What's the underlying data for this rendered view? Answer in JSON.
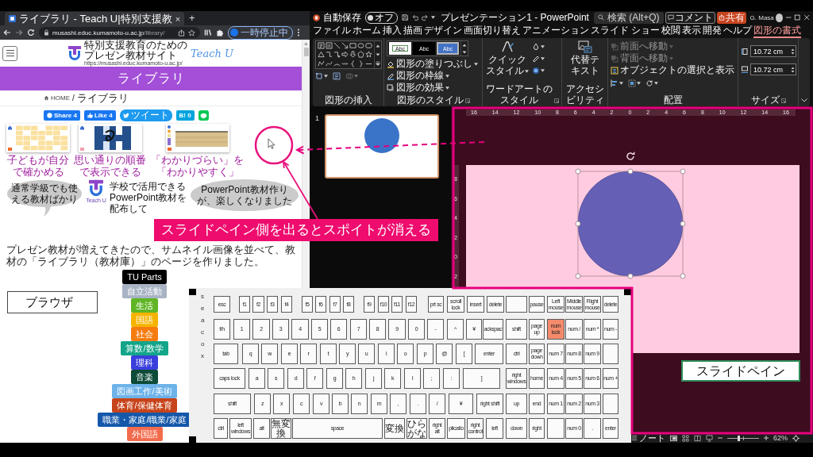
{
  "browser": {
    "tab": {
      "title": "ライブラリ - Teach U|特別支援教",
      "close": "×"
    },
    "new_tab": "+",
    "address": {
      "host": "musashi.educ.kumamoto-u.ac.jp",
      "path": "/library/"
    },
    "profile": {
      "status": "一時停止中"
    },
    "page": {
      "logo": {
        "line_1": "特別支援教育のための",
        "line_2": "プレゼン教材サイト",
        "url": "https://musashi.educ.kumamoto-u.ac.jp/",
        "brand": "Teach U"
      },
      "banner_title": "ライブラリ",
      "breadcrumb": {
        "home": "HOME",
        "separator": "/",
        "current": "ライブラリ"
      },
      "share_buttons": [
        {
          "kind": "share",
          "label": "Share 4"
        },
        {
          "kind": "like",
          "label": "Like 4"
        },
        {
          "kind": "tweet",
          "label": "ツイート"
        },
        {
          "kind": "bookmark",
          "label": "B! 0"
        },
        {
          "kind": "chat"
        }
      ],
      "thumbnails": [
        {
          "kind": "kana_grid",
          "caption": "子どもが自分で確かめる"
        },
        {
          "kind": "letter_tile",
          "caption": "思い通りの順番で表示できる"
        },
        {
          "kind": "ruler",
          "caption": "「わかりづらい」を「わかりやすく」"
        }
      ],
      "speech_bubble": "通常学級でも使える教材ばかり",
      "logo_caption": "Teach U",
      "intro_lines": [
        "学校で活用できる",
        "PowerPoint教材を",
        "配布して"
      ],
      "thought_bubble": "PowerPoint教材作りが、楽しくなりました",
      "paragraph": "プレゼン教材が増えてきたので、サムネイル画像を並べて、教材の「ライブラリ（教材庫）」のページを作りました。",
      "categories": [
        {
          "label": "TU Parts",
          "color": "#000000"
        },
        {
          "label": "自立活動",
          "color": "#a8b3c4"
        },
        {
          "label": "生活",
          "color": "#5fb524"
        },
        {
          "label": "国語",
          "color": "#f6b400"
        },
        {
          "label": "社会",
          "color": "#f67c0f"
        },
        {
          "label": "算数/数学",
          "color": "#12a58a"
        },
        {
          "label": "理科",
          "color": "#3a3fdc"
        },
        {
          "label": "音楽",
          "color": "#0d4a38"
        },
        {
          "label": "図画工作/美術",
          "color": "#6db3ea"
        },
        {
          "label": "体育/保健体育",
          "color": "#c7431a"
        },
        {
          "label": "職業・家庭/職業/家庭",
          "color": "#1558aa"
        },
        {
          "label": "外国語",
          "color": "#f26b4c"
        }
      ]
    }
  },
  "powerpoint": {
    "title_bar": {
      "autosave_label": "自動保存",
      "autosave": {
        "on": false,
        "label": "オフ"
      },
      "document_title": "プレゼンテーション1 - PowerPoint",
      "search_placeholder": "検索 (Alt+Q)",
      "user_name": "G. Masa"
    },
    "tabs": [
      {
        "label": "ファイル",
        "selected": false
      },
      {
        "label": "ホーム",
        "selected": false
      },
      {
        "label": "挿入",
        "selected": false
      },
      {
        "label": "描画",
        "selected": false
      },
      {
        "label": "デザイン",
        "selected": false
      },
      {
        "label": "画面切り替え",
        "selected": false
      },
      {
        "label": "アニメーション",
        "selected": false
      },
      {
        "label": "スライド ショー",
        "selected": false
      },
      {
        "label": "校閲",
        "selected": false
      },
      {
        "label": "表示",
        "selected": false
      },
      {
        "label": "開発",
        "selected": false
      },
      {
        "label": "ヘルプ",
        "selected": false
      },
      {
        "label": "図形の書式",
        "selected": true
      }
    ],
    "comment_button": "コメント",
    "share_button": "共有",
    "ribbon": {
      "insert_shapes_label": "図形の挿入",
      "shape_styles": {
        "label": "図形のスタイル",
        "swatches": [
          {
            "kind": "outline",
            "label": "Abc",
            "selected": false
          },
          {
            "kind": "dark",
            "label": "Abc",
            "selected": false
          },
          {
            "kind": "accent",
            "label": "Abc",
            "selected": true
          }
        ],
        "commands": [
          {
            "kind": "fill",
            "label": "図形の塗りつぶし"
          },
          {
            "kind": "outline",
            "label": "図形の枠線"
          },
          {
            "kind": "effects",
            "label": "図形の効果"
          }
        ]
      },
      "wordart": {
        "label": "ワードアートのスタイル",
        "quick_styles": "クイックスタイル"
      },
      "accessibility": {
        "label": "アクセシビリティ",
        "alt_text": "代替テキスト"
      },
      "arrange": {
        "label": "配置",
        "commands": [
          {
            "kind": "bring_forward",
            "label": "前面へ移動",
            "disabled": true
          },
          {
            "kind": "send_backward",
            "label": "背面へ移動",
            "disabled": true
          },
          {
            "kind": "selection_pane",
            "label": "オブジェクトの選択と表示",
            "disabled": false
          }
        ]
      },
      "size": {
        "label": "サイズ",
        "fields": [
          {
            "kind": "height",
            "value": "10.72 cm"
          },
          {
            "kind": "width",
            "value": "10.72 cm"
          }
        ]
      }
    },
    "slides": [
      {
        "number": "1",
        "selected": true
      }
    ],
    "rulers": {
      "horizontal": [
        "16",
        "14",
        "12",
        "10",
        "8",
        "6",
        "4",
        "2",
        "0",
        "2",
        "4",
        "6",
        "8",
        "10",
        "12",
        "14",
        "16"
      ],
      "vertical": [
        "8",
        "6",
        "4",
        "2",
        "0",
        "2"
      ]
    },
    "status_bar": {
      "notes": "ノート",
      "zoom": "62%",
      "zoom_slider": {
        "level": 0.35
      }
    }
  },
  "keyboard": {
    "side_text": "seacox",
    "function_row": [
      {
        "label": "esc",
        "on": false
      },
      {
        "label": "f1",
        "on": false
      },
      {
        "label": "f2",
        "on": false
      },
      {
        "label": "f3",
        "on": false
      },
      {
        "label": "f4",
        "on": false
      },
      {
        "label": "f5",
        "on": false
      },
      {
        "label": "f6",
        "on": false
      },
      {
        "label": "f7",
        "on": false
      },
      {
        "label": "f8",
        "on": false
      },
      {
        "label": "f9",
        "on": false
      },
      {
        "label": "f10",
        "on": false
      },
      {
        "label": "f11",
        "on": false
      },
      {
        "label": "f12",
        "on": false
      },
      {
        "label": "prt sc",
        "on": false
      },
      {
        "label": "scroll lock",
        "on": false
      },
      {
        "label": "insert",
        "on": false
      },
      {
        "label": "delete",
        "on": false
      }
    ],
    "number_row": [
      {
        "label": "f/h",
        "on": false
      },
      {
        "label": "1",
        "on": false
      },
      {
        "label": "2",
        "on": false
      },
      {
        "label": "3",
        "on": false
      },
      {
        "label": "4",
        "on": false
      },
      {
        "label": "5",
        "on": false
      },
      {
        "label": "6",
        "on": false
      },
      {
        "label": "7",
        "on": false
      },
      {
        "label": "8",
        "on": false
      },
      {
        "label": "9",
        "on": false
      },
      {
        "label": "0",
        "on": false
      },
      {
        "label": "-",
        "on": false
      },
      {
        "label": "^",
        "on": false
      },
      {
        "label": "¥",
        "on": false
      },
      {
        "label": "ackspac",
        "on": false
      }
    ],
    "top_row": [
      {
        "label": "tab",
        "on": false
      },
      {
        "label": "q",
        "on": false
      },
      {
        "label": "w",
        "on": false
      },
      {
        "label": "e",
        "on": false
      },
      {
        "label": "r",
        "on": false
      },
      {
        "label": "t",
        "on": false
      },
      {
        "label": "y",
        "on": false
      },
      {
        "label": "u",
        "on": false
      },
      {
        "label": "i",
        "on": false
      },
      {
        "label": "o",
        "on": false
      },
      {
        "label": "p",
        "on": false
      },
      {
        "label": "@",
        "on": false
      },
      {
        "label": "[",
        "on": false
      },
      {
        "label": "enter",
        "on": false
      }
    ],
    "home_row": [
      {
        "label": "caps lock",
        "on": false
      },
      {
        "label": "a",
        "on": false
      },
      {
        "label": "s",
        "on": false
      },
      {
        "label": "d",
        "on": false
      },
      {
        "label": "f",
        "on": false
      },
      {
        "label": "g",
        "on": false
      },
      {
        "label": "h",
        "on": false
      },
      {
        "label": "j",
        "on": false
      },
      {
        "label": "k",
        "on": false
      },
      {
        "label": "l",
        "on": false
      },
      {
        "label": ";",
        "on": false
      },
      {
        "label": ":",
        "on": false
      },
      {
        "label": "]",
        "on": false
      }
    ],
    "bottom_row": [
      {
        "label": "shift",
        "on": false
      },
      {
        "label": "z",
        "on": false
      },
      {
        "label": "x",
        "on": false
      },
      {
        "label": "c",
        "on": false
      },
      {
        "label": "v",
        "on": false
      },
      {
        "label": "b",
        "on": false
      },
      {
        "label": "n",
        "on": false
      },
      {
        "label": "m",
        "on": false
      },
      {
        "label": ",",
        "on": false
      },
      {
        "label": ".",
        "on": false
      },
      {
        "label": "/",
        "on": false
      },
      {
        "label": "¥",
        "on": false
      },
      {
        "label": "right shift",
        "on": false
      }
    ],
    "space_row": [
      {
        "label": "ctrl",
        "on": false
      },
      {
        "label": "left windows",
        "on": false
      },
      {
        "label": "alt",
        "on": false
      },
      {
        "label": "無変換",
        "on": false
      },
      {
        "label": "space",
        "on": false
      },
      {
        "label": "変換",
        "on": false
      },
      {
        "label": "ひらがな",
        "on": false
      },
      {
        "label": "right alt",
        "on": false
      },
      {
        "label": "plicatio",
        "on": false
      },
      {
        "label": "right control",
        "on": false
      },
      {
        "label": "left",
        "on": false
      }
    ],
    "nav_rows": [
      [
        {
          "on": false
        },
        {
          "label": "pause",
          "on": false
        }
      ],
      [
        {
          "label": "shift",
          "on": false
        },
        {
          "label": "page up",
          "on": false
        }
      ],
      [
        {
          "label": "ctrl",
          "on": false
        },
        {
          "label": "page down",
          "on": false
        }
      ],
      [
        {
          "label": "right windows",
          "on": false
        },
        {
          "label": "home",
          "on": false
        }
      ],
      [
        {
          "label": "up",
          "on": false
        },
        {
          "label": "end",
          "on": false
        }
      ],
      [
        {
          "label": "down",
          "on": false
        },
        {
          "label": "right",
          "on": false
        }
      ]
    ],
    "numpad_rows": [
      [
        {
          "label": "Left mouse",
          "on": false
        },
        {
          "label": "Middle mouse",
          "on": false
        },
        {
          "label": "Right mouse",
          "on": false
        },
        {
          "label": "delete",
          "on": false
        }
      ],
      [
        {
          "label": "num lock",
          "on": true
        },
        {
          "label": "num /",
          "on": false
        },
        {
          "label": "num *",
          "on": false
        },
        {
          "label": "num -",
          "on": false
        }
      ],
      [
        {
          "label": "num 7",
          "on": false
        },
        {
          "label": "num 8",
          "on": false
        },
        {
          "label": "num 9",
          "on": false
        },
        {
          "on": false
        }
      ],
      [
        {
          "label": "num 4",
          "on": false
        },
        {
          "label": "num 5",
          "on": false
        },
        {
          "label": "num 6",
          "on": false
        },
        {
          "label": "num +",
          "on": false
        }
      ],
      [
        {
          "label": "num 1",
          "on": false
        },
        {
          "label": "num 2",
          "on": false
        },
        {
          "label": "num 3",
          "on": false
        },
        {
          "on": false
        }
      ],
      [
        {
          "on": false
        },
        {
          "label": "num 0",
          "on": false
        },
        {
          "label": ".",
          "on": false
        },
        {
          "label": "enter",
          "on": false
        }
      ]
    ]
  },
  "annotations": {
    "callout": "スライドペイン側を出るとスポイトが消える",
    "browser_label": "ブラウザ",
    "slide_pane_label": "スライドペイン"
  }
}
